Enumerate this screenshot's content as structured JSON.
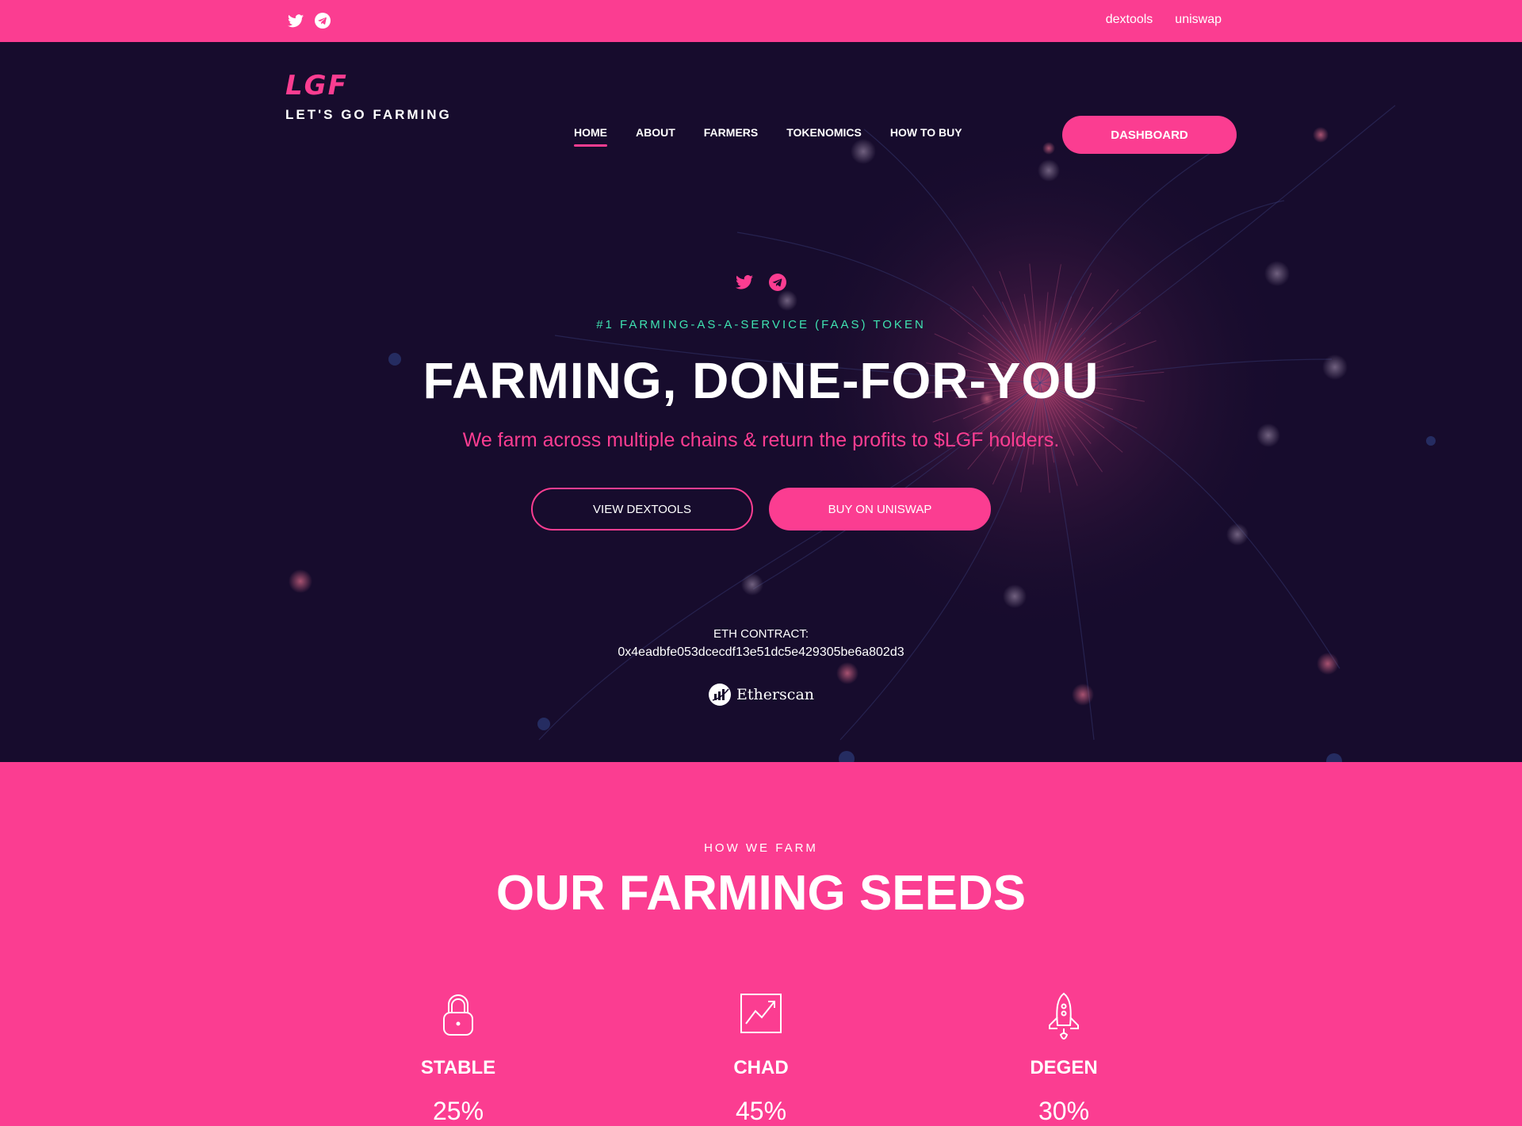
{
  "topbar": {
    "social_icons": [
      "twitter-icon",
      "telegram-icon"
    ],
    "links": [
      "dextools",
      "uniswap"
    ]
  },
  "brand": {
    "logo_mark": "LGF",
    "name": "LET'S GO FARMING"
  },
  "nav": {
    "items": [
      "HOME",
      "ABOUT",
      "FARMERS",
      "TOKENOMICS",
      "HOW TO BUY"
    ],
    "active": "HOME",
    "cta": "DASHBOARD"
  },
  "hero": {
    "social_icons": [
      "twitter-icon",
      "telegram-icon"
    ],
    "tagline": "#1 FARMING-AS-A-SERVICE (FAAS) TOKEN",
    "headline": "FARMING, DONE-FOR-YOU",
    "subline": "We farm across multiple chains & return the profits to $LGF holders.",
    "buttons": {
      "secondary": "VIEW DEXTOOLS",
      "primary": "BUY ON UNISWAP"
    },
    "contract_label": "ETH CONTRACT:",
    "contract_address": "0x4eadbfe053dcecdf13e51dc5e429305be6a802d3",
    "etherscan_label": "Etherscan"
  },
  "farming": {
    "eyebrow": "HOW WE FARM",
    "title": "OUR FARMING SEEDS",
    "seeds": [
      {
        "name": "STABLE",
        "percent": "25%",
        "icon": "lock-icon"
      },
      {
        "name": "CHAD",
        "percent": "45%",
        "icon": "chart-icon"
      },
      {
        "name": "DEGEN",
        "percent": "30%",
        "icon": "rocket-icon"
      }
    ]
  },
  "colors": {
    "brand_pink": "#fb3d91",
    "hero_bg": "#170c2d",
    "accent_green": "#3fe3b1",
    "text_white": "#ffffff"
  }
}
